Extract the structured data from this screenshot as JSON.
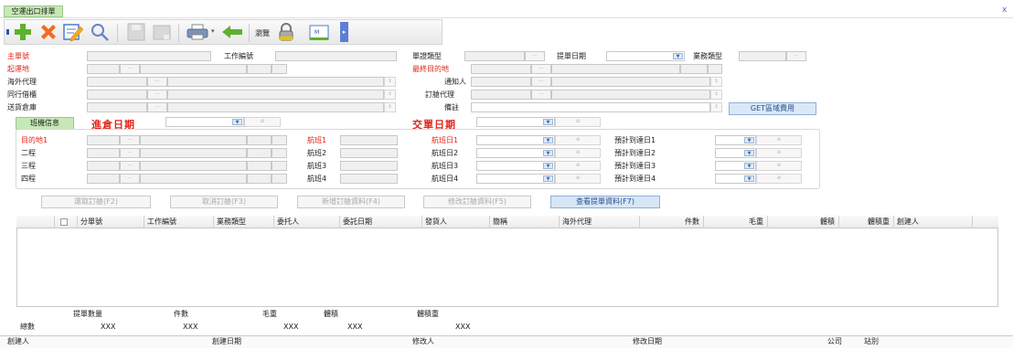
{
  "window": {
    "tab_label": "空運出口排單",
    "close_label": "x"
  },
  "toolbar": {
    "browse_label": "瀏覽"
  },
  "form": {
    "main_no": "主單號",
    "job_no": "工作編號",
    "doc_type": "單證類型",
    "bl_date": "提單日期",
    "business_type": "業務類型",
    "origin": "起運地",
    "final_dest": "最終目的地",
    "overseas_agent": "海外代理",
    "notify": "通知人",
    "peer_agent": "同行借櫃",
    "booking_agent": "訂艙代理",
    "delivery_wh": "送貨倉庫",
    "remark": "備註",
    "get_fee_button": "GET區域費用",
    "flight_tab": "班機信息",
    "in_wh_date": "進倉日期",
    "handover_date": "交單日期"
  },
  "legs": [
    {
      "label": "目的地1",
      "flight": "航班1",
      "flight_date": "航班日1",
      "eta": "預計到達日1"
    },
    {
      "label": "二程",
      "flight": "航班2",
      "flight_date": "航班日2",
      "eta": "預計到達日2"
    },
    {
      "label": "三程",
      "flight": "航班3",
      "flight_date": "航班日3",
      "eta": "預計到達日3"
    },
    {
      "label": "四程",
      "flight": "航班4",
      "flight_date": "航班日4",
      "eta": "預計到達日4"
    }
  ],
  "actions": {
    "fetch": "選取訂艙(F2)",
    "cancel": "取消訂艙(F3)",
    "add": "新增訂艙資料(F4)",
    "modify": "修改訂艙資料(F5)",
    "view": "查看提單資料(F7)"
  },
  "table": {
    "columns": [
      "分單號",
      "工作編號",
      "業務類型",
      "委托人",
      "委託日期",
      "發貨人",
      "簡稱",
      "海外代理",
      "件數",
      "毛重",
      "體積",
      "體積重",
      "創建人"
    ]
  },
  "summary": {
    "headers": [
      "提單數量",
      "件數",
      "毛重",
      "體積",
      "體積重"
    ],
    "row_label": "總數",
    "values": [
      "XXX",
      "XXX",
      "XXX",
      "XXX",
      "XXX"
    ]
  },
  "footer": {
    "creator": "創建人",
    "created_date": "創建日期",
    "modifier": "修改人",
    "modified_date": "修改日期",
    "company": "公司",
    "station": "站別"
  },
  "colors": {
    "accent_red": "#e0261b",
    "tab_green": "#c6e8b6",
    "view_button_blue": "#d7e6f7"
  }
}
